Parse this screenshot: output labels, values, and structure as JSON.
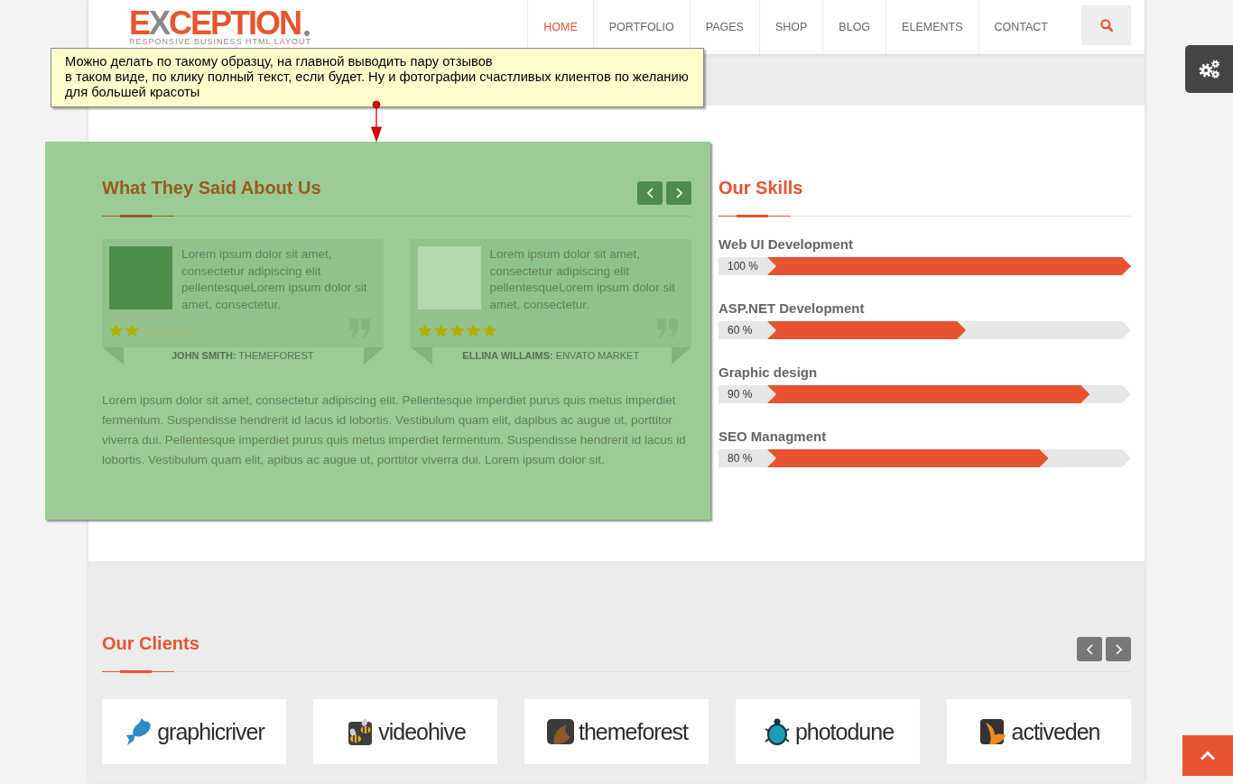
{
  "header": {
    "logo": {
      "title": "EXCEPTION",
      "tagline": "RESPONSIVE BUSINESS HTML LAYOUT"
    },
    "nav": [
      {
        "label": "HOME",
        "selected": true
      },
      {
        "label": "PORTFOLIO",
        "selected": false
      },
      {
        "label": "PAGES",
        "selected": false
      },
      {
        "label": "SHOP",
        "selected": false
      },
      {
        "label": "BLOG",
        "selected": false
      },
      {
        "label": "ELEMENTS",
        "selected": false
      },
      {
        "label": "CONTACT",
        "selected": false
      }
    ]
  },
  "note": {
    "text": "Можно делать по такому образцу, на главной выводить пару отзывов\nв таком виде, по клику полный текст, если будет. Ну и фотографии счастливых клиентов по желанию\nдля большей красоты"
  },
  "testimonials": {
    "title": "What They Said About Us",
    "items": [
      {
        "quote": "Lorem ipsum dolor sit amet, consectetur adipiscing elit pellentesqueLorem ipsum dolor sit amet, consectetur.",
        "stars": 2,
        "author": "**JOHN SMITH:** THEMEFOREST"
      },
      {
        "quote": "Lorem ipsum dolor sit amet, consectetur adipiscing elit pellentesqueLorem ipsum dolor sit amet, consectetur.",
        "stars": 5,
        "author": "**ELLINA WILLAIMS:** ENVATO MARKET"
      }
    ],
    "text": "Lorem ipsum dolor sit amet, consectetur adipiscing elit. Pellentesque imperdiet purus quis metus imperdiet fermentum. Suspendisse hendrerit id lacus id lobortis. Vestibulum quam elit, dapibus ac augue ut, porttitor viverra dui. Pellentesque imperdiet purus quis metus imperdiet fermentum. Suspendisse hendrerit id lacus id lobortis. Vestibulum quam elit, apibus ac augue ut, porttitor viverra dui. Lorem ipsum dolor sit."
  },
  "skills": {
    "title": "Our Skills",
    "items": [
      {
        "name": "Web UI Development",
        "reading": "100 %",
        "level": 1
      },
      {
        "name": "ASP.NET Development",
        "reading": "60 %",
        "level": 0.6
      },
      {
        "name": "Graphic design",
        "reading": "90 %",
        "level": 0.9
      },
      {
        "name": "SEO Managment",
        "reading": "80 %",
        "level": 0.8
      }
    ]
  },
  "clients": {
    "title": "Our Clients",
    "logos": [
      "graphicriver",
      "videohive",
      "themeforest",
      "photodune",
      "activeden"
    ]
  }
}
